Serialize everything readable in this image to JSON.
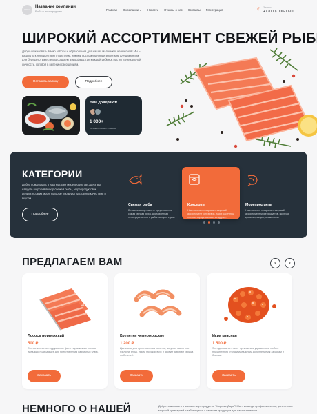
{
  "header": {
    "logo_text": "LOGO",
    "brand_name": "Название компании",
    "brand_sub": "Рыба и морепродукты",
    "nav": [
      "Главная",
      "О компании",
      "Новости",
      "Отзывы о нас",
      "Контакты",
      "Регистрация"
    ],
    "phone_label": "Звонок",
    "phone": "+7 (000) 000-00-00"
  },
  "hero": {
    "title": "ШИРОКИЙ АССОРТИМЕНТ СВЕЖЕЙ РЫБЫ",
    "text": "Добро пожаловать в мир заботы и образования для наших маленьких чемпионов! Мы – ваш путь к невероятным открытиям, яркими воспоминаниями и крепким фундаментом для будущего. Вместе мы создаем атмосферу, где каждый ребенок растет в уникальной личности, готовой в велении свершениям.",
    "btn_order": "Оставить заявку",
    "btn_more": "Подробнее",
    "trust_title": "Нам доверяют!",
    "trust_count": "1 000+",
    "trust_sub": "положительных отзывов"
  },
  "categories": {
    "title": "КАТЕГОРИИ",
    "text": "Добро пожаловать в наш магазин морепродуктов! Здесь вы найдете широкий выбор свежей рыбы, морепродуктов и деликатесов из моря, которые порадуют вас своим качеством и вкусом.",
    "btn": "Подробнее",
    "items": [
      {
        "name": "Свежая рыба",
        "desc": "В нашем ассортименте представлена самая свежая рыба, доставленная непосредственно с рыболовецких судов."
      },
      {
        "name": "Консервы",
        "desc": "Наш магазин предлагает широкий ассортимент консервов, таких как тунец, лосось, сардины и многие другие."
      },
      {
        "name": "Морепродукты",
        "desc": "Наш магазин предлагает широкий ассортимент морепродуктов, включая креветки, мидии, осьминогов."
      }
    ],
    "active_index": 1
  },
  "offers": {
    "title": "ПРЕДЛАГАЕМ ВАМ",
    "prev": "‹",
    "next": "›",
    "products": [
      {
        "name": "Лосось норвежский",
        "price": "500 ₽",
        "desc": "Сочное и нежное подрумянное филе норвежского лосося, идеально подходящее для приготовления различных блюд.",
        "button": "Заказать"
      },
      {
        "name": "Креветки черноморские",
        "price": "1 200 ₽",
        "desc": "Идеальны для приготовления салатов, закусок, пасты или гриля на блюд. Яркий морской вкус и аромат завоюют сердца любителей.",
        "button": "Заказать"
      },
      {
        "name": "Икра красная",
        "price": "1 500 ₽",
        "desc": "Этот деликатес станет прекрасным украшением любого праздничного стола и идеальным дополнением к закускам и блинам.",
        "button": "Заказать"
      }
    ]
  },
  "about": {
    "title": "НЕМНОГО О НАШЕЙ",
    "text": "Добро пожаловать в магазин морепродуктов \"Морские Дары\"! Мы – команда профессионалов, увлеченных морской кулинарией и заботящихся о качестве продукции для наших клиентов."
  },
  "colors": {
    "accent": "#f26b3a",
    "dark_panel": "#26313b"
  }
}
